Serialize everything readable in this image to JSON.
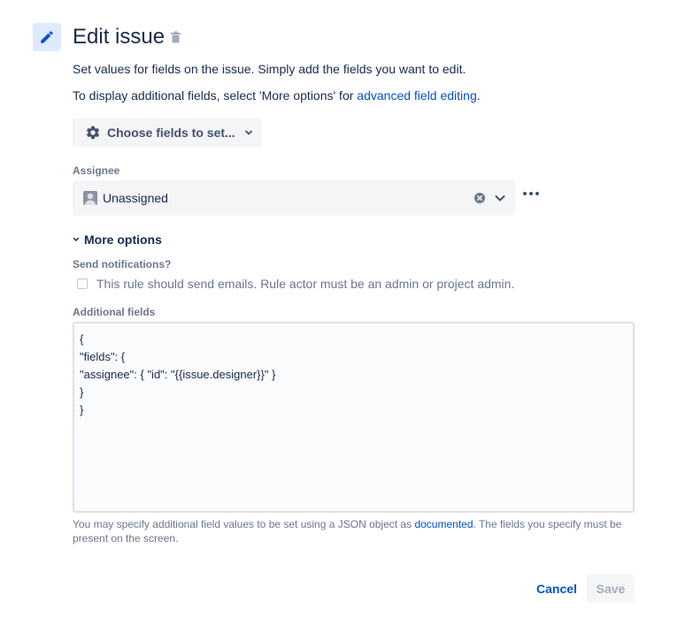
{
  "header": {
    "title": "Edit issue",
    "icon": "pencil-icon",
    "delete_icon": "trash-icon"
  },
  "description": {
    "line1": "Set values for fields on the issue. Simply add the fields you want to edit.",
    "line2_prefix": "To display additional fields, select 'More options' for ",
    "line2_link": "advanced field editing",
    "line2_suffix": "."
  },
  "choose_fields": {
    "label": "Choose fields to set...",
    "icon": "gear-icon"
  },
  "assignee": {
    "label": "Assignee",
    "value": "Unassigned"
  },
  "more_options": {
    "label": "More options"
  },
  "notifications": {
    "label": "Send notifications?",
    "checkbox_label": "This rule should send emails. Rule actor must be an admin or project admin.",
    "checked": false
  },
  "additional_fields": {
    "label": "Additional fields",
    "value": "{\n\"fields\": {\n\"assignee\": { \"id\": \"{{issue.designer}}\" }\n}\n}",
    "help_prefix": "You may specify additional field values to be set using a JSON object as ",
    "help_link": "documented",
    "help_suffix": ". The fields you specify must be present on the screen."
  },
  "actions": {
    "cancel_label": "Cancel",
    "save_label": "Save"
  },
  "colors": {
    "link": "#0052cc",
    "text": "#172b4d",
    "subtle": "#6b778c",
    "icon_bg": "#deebff"
  }
}
